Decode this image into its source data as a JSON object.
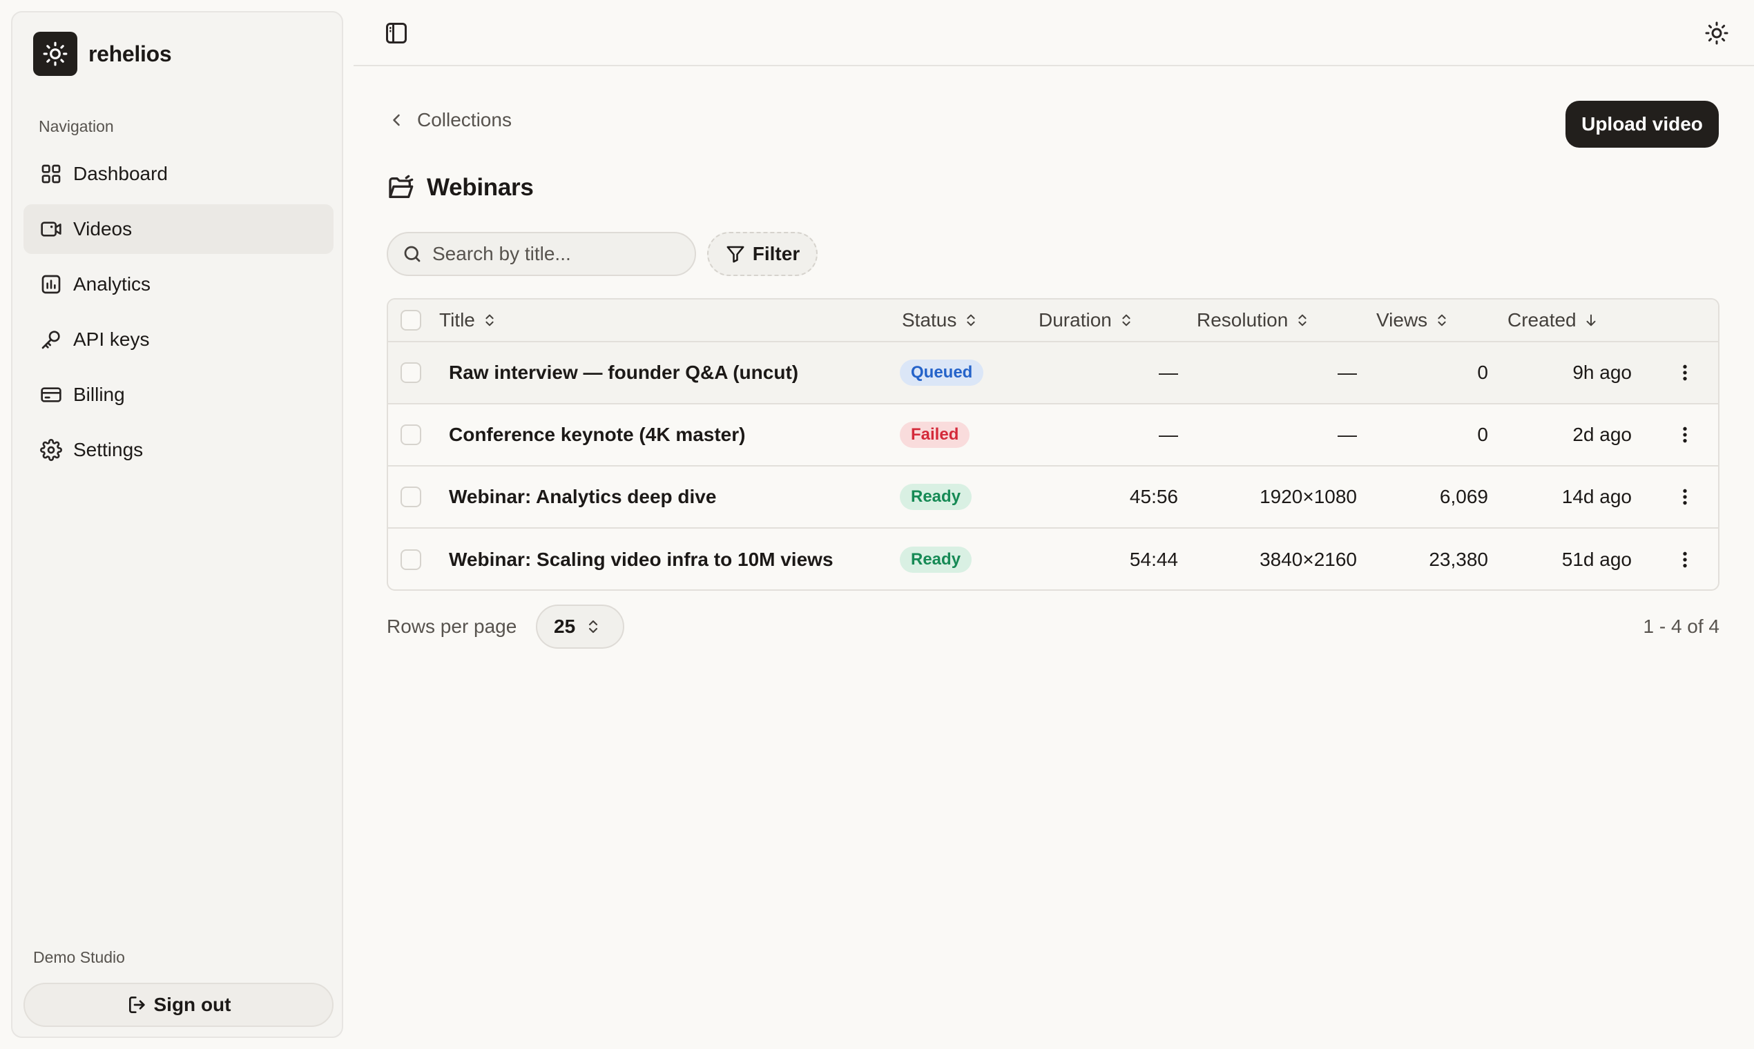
{
  "sidebar": {
    "brand": {
      "name": "rehelios",
      "icon": "sun-icon"
    },
    "nav_label": "Navigation",
    "items": [
      {
        "label": "Dashboard",
        "icon": "grid-icon",
        "active": false
      },
      {
        "label": "Videos",
        "icon": "video-icon",
        "active": true
      },
      {
        "label": "Analytics",
        "icon": "chart-icon",
        "active": false
      },
      {
        "label": "API keys",
        "icon": "key-icon",
        "active": false
      },
      {
        "label": "Billing",
        "icon": "credit-card-icon",
        "active": false
      },
      {
        "label": "Settings",
        "icon": "gear-icon",
        "active": false
      }
    ],
    "workspace": "Demo Studio",
    "sign_out_label": "Sign out"
  },
  "topbar": {
    "left_icon": "sidebar-toggle-icon",
    "right_icon": "sun-icon"
  },
  "main": {
    "breadcrumb": "Collections",
    "upload_label": "Upload video",
    "title": "Webinars",
    "search": {
      "placeholder": "Search by title...",
      "value": ""
    },
    "filter_label": "Filter",
    "table": {
      "columns": {
        "title": "Title",
        "status": "Status",
        "duration": "Duration",
        "resolution": "Resolution",
        "views": "Views",
        "created": "Created"
      },
      "sort": {
        "column": "Created",
        "direction": "descending"
      },
      "rows": [
        {
          "title": "Raw interview — founder Q&A (uncut)",
          "status": "Queued",
          "duration": "—",
          "resolution": "—",
          "views": "0",
          "created": "9h ago"
        },
        {
          "title": "Conference keynote (4K master)",
          "status": "Failed",
          "duration": "—",
          "resolution": "—",
          "views": "0",
          "created": "2d ago"
        },
        {
          "title": "Webinar: Analytics deep dive",
          "status": "Ready",
          "duration": "45:56",
          "resolution": "1920×1080",
          "views": "6,069",
          "created": "14d ago"
        },
        {
          "title": "Webinar: Scaling video infra to 10M views",
          "status": "Ready",
          "duration": "54:44",
          "resolution": "3840×2160",
          "views": "23,380",
          "created": "51d ago"
        }
      ]
    },
    "rows_per_page_label": "Rows per page",
    "rows_per_page": "25",
    "pagination": "1 - 4 of 4"
  },
  "colors": {
    "background": "#faf9f6",
    "primary": "#221f1c",
    "queued": "#2563c9",
    "failed": "#d42a3a",
    "ready": "#168a55"
  }
}
